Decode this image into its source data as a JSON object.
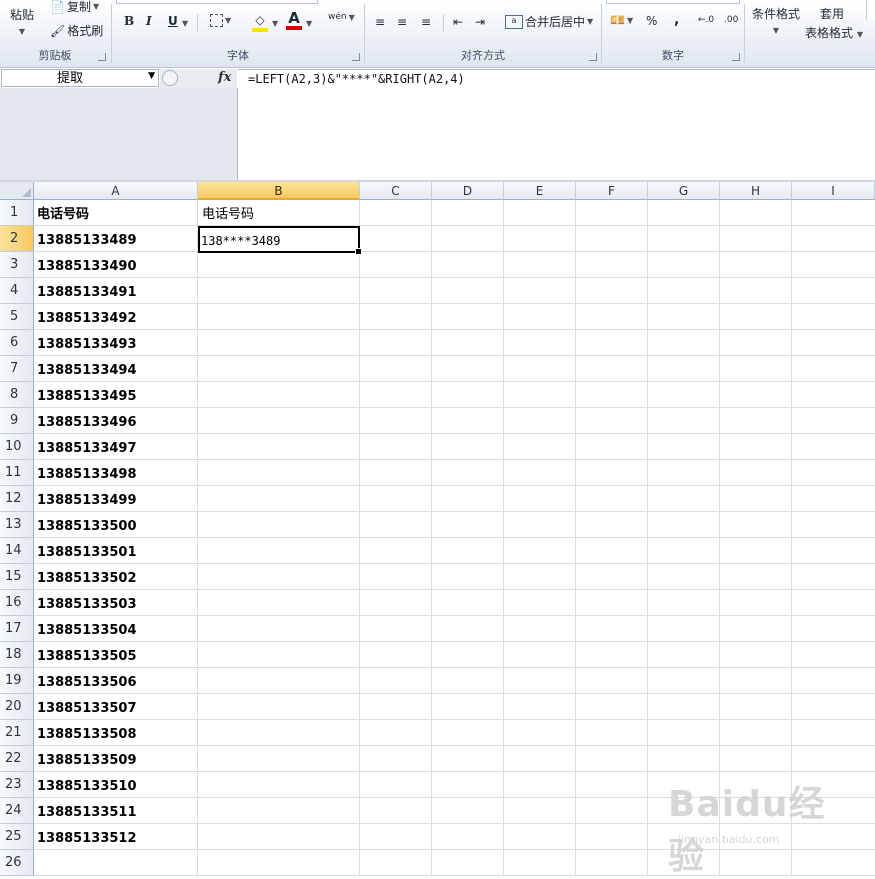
{
  "ribbon": {
    "clipboard": {
      "paste_label": "粘贴",
      "copy_label": "复制",
      "format_painter_label": "格式刷",
      "group_label": "剪贴板"
    },
    "font": {
      "group_label": "字体",
      "bold": "B",
      "italic": "I",
      "underline": "U",
      "fill_color_glyph": "◇",
      "font_color_glyph": "A",
      "phonetic_glyph": "wén",
      "accent_fill": "#f5e300",
      "accent_font": "#e00000"
    },
    "alignment": {
      "merge_center_label": "合并后居中",
      "group_label": "对齐方式"
    },
    "number": {
      "group_label": "数字",
      "percent": "%",
      "comma": ",",
      "inc_decimal": "←.0",
      "dec_decimal": ".00"
    },
    "styles": {
      "conditional_format_label": "条件格式",
      "table_format_label": "套用",
      "table_format_label2": "表格格式"
    }
  },
  "formula_bar": {
    "name_box": "提取",
    "fx": "fx",
    "formula": "=LEFT(A2,3)&\"****\"&RIGHT(A2,4)"
  },
  "columns": [
    "A",
    "B",
    "C",
    "D",
    "E",
    "F",
    "G",
    "H",
    "I"
  ],
  "selected_column": "B",
  "selected_row": "2",
  "rows": [
    {
      "num": "1",
      "a": "电话号码",
      "b": "电话号码"
    },
    {
      "num": "2",
      "a": "13885133489",
      "b": "138****3489"
    },
    {
      "num": "3",
      "a": "13885133490",
      "b": ""
    },
    {
      "num": "4",
      "a": "13885133491",
      "b": ""
    },
    {
      "num": "5",
      "a": "13885133492",
      "b": ""
    },
    {
      "num": "6",
      "a": "13885133493",
      "b": ""
    },
    {
      "num": "7",
      "a": "13885133494",
      "b": ""
    },
    {
      "num": "8",
      "a": "13885133495",
      "b": ""
    },
    {
      "num": "9",
      "a": "13885133496",
      "b": ""
    },
    {
      "num": "10",
      "a": "13885133497",
      "b": ""
    },
    {
      "num": "11",
      "a": "13885133498",
      "b": ""
    },
    {
      "num": "12",
      "a": "13885133499",
      "b": ""
    },
    {
      "num": "13",
      "a": "13885133500",
      "b": ""
    },
    {
      "num": "14",
      "a": "13885133501",
      "b": ""
    },
    {
      "num": "15",
      "a": "13885133502",
      "b": ""
    },
    {
      "num": "16",
      "a": "13885133503",
      "b": ""
    },
    {
      "num": "17",
      "a": "13885133504",
      "b": ""
    },
    {
      "num": "18",
      "a": "13885133505",
      "b": ""
    },
    {
      "num": "19",
      "a": "13885133506",
      "b": ""
    },
    {
      "num": "20",
      "a": "13885133507",
      "b": ""
    },
    {
      "num": "21",
      "a": "13885133508",
      "b": ""
    },
    {
      "num": "22",
      "a": "13885133509",
      "b": ""
    },
    {
      "num": "23",
      "a": "13885133510",
      "b": ""
    },
    {
      "num": "24",
      "a": "13885133511",
      "b": ""
    },
    {
      "num": "25",
      "a": "13885133512",
      "b": ""
    },
    {
      "num": "26",
      "a": "",
      "b": ""
    }
  ],
  "watermark": {
    "brand": "Baidu经验",
    "url": "jingyan.baidu.com"
  }
}
